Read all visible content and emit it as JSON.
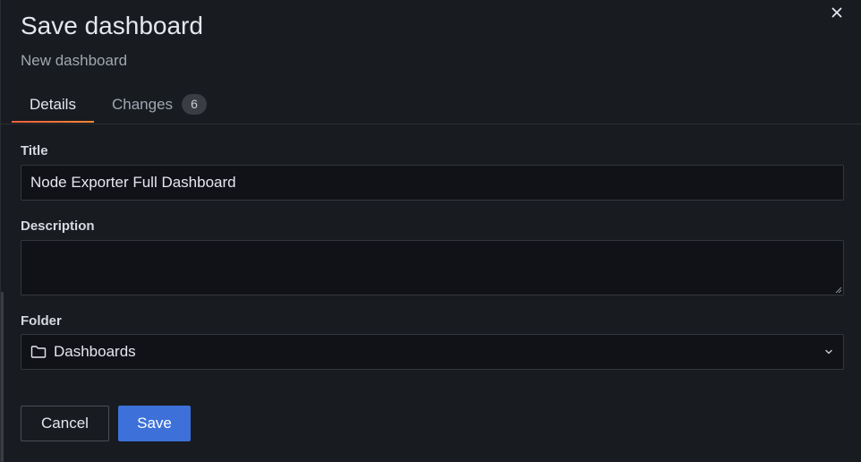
{
  "drawer": {
    "title": "Save dashboard",
    "subtitle": "New dashboard"
  },
  "tabs": [
    {
      "label": "Details",
      "active": true
    },
    {
      "label": "Changes",
      "count": "6",
      "active": false
    }
  ],
  "form": {
    "title_label": "Title",
    "title_value": "Node Exporter Full Dashboard",
    "description_label": "Description",
    "description_value": "",
    "folder_label": "Folder",
    "folder_value": "Dashboards"
  },
  "actions": {
    "cancel_label": "Cancel",
    "save_label": "Save"
  },
  "icons": {
    "close": "close-icon",
    "folder": "folder-icon",
    "dropdown": "chevron-down-icon"
  },
  "colors": {
    "background": "#181b1f",
    "input_background": "#111217",
    "primary": "#3d71d9",
    "tab_accent": "#f55f3e"
  }
}
